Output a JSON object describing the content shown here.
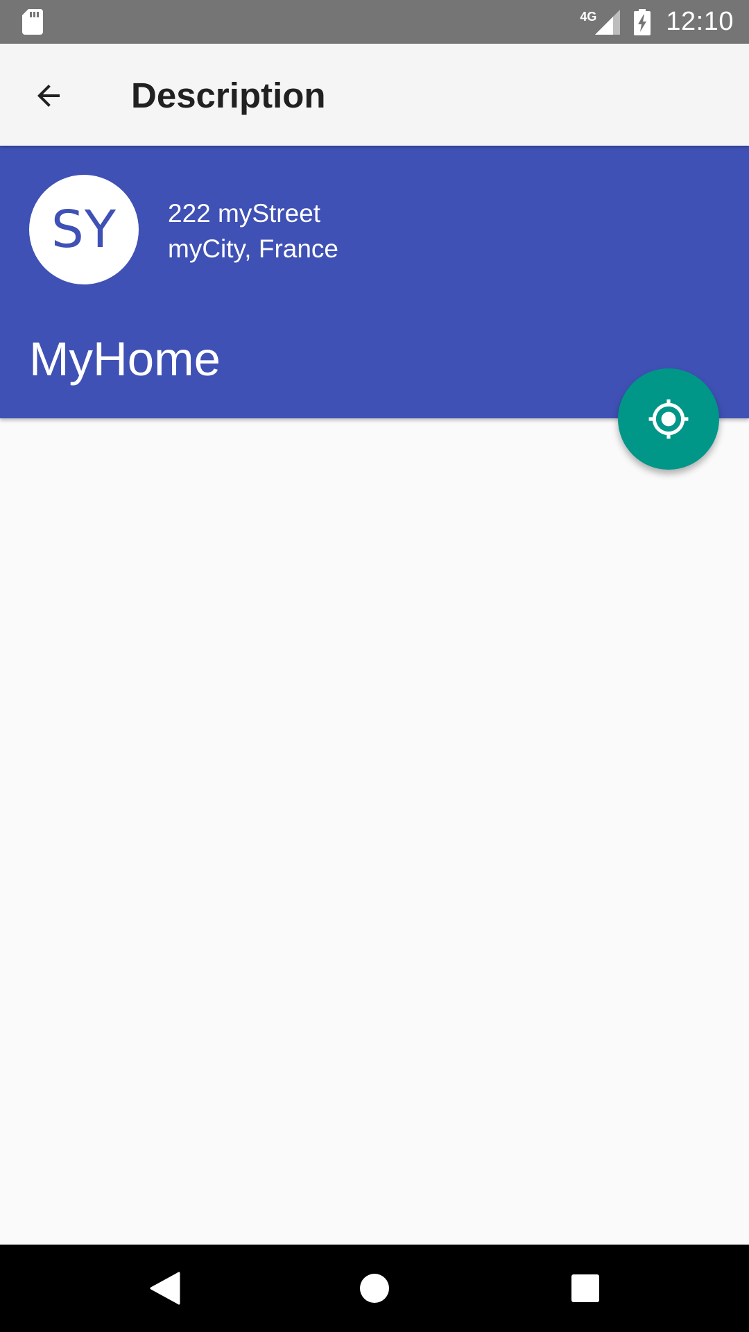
{
  "status_bar": {
    "network_type": "4G",
    "time": "12:10",
    "icons": [
      "sd-card-icon",
      "signal-icon",
      "battery-charging-icon"
    ]
  },
  "app_bar": {
    "title": "Description",
    "back_icon": "arrow-back-icon"
  },
  "header": {
    "avatar_initials": "SY",
    "address_line1": "222 myStreet",
    "address_line2": "myCity, France",
    "place_name": "MyHome",
    "background_color": "#3f51b5"
  },
  "fab": {
    "icon": "my-location-icon",
    "color": "#009688"
  },
  "nav_bar": {
    "buttons": [
      "nav-back-icon",
      "nav-home-icon",
      "nav-recents-icon"
    ]
  },
  "colors": {
    "status_bar": "#757575",
    "app_bar": "#f5f5f5",
    "primary": "#3f51b5",
    "accent": "#009688",
    "background": "#fafafa"
  }
}
